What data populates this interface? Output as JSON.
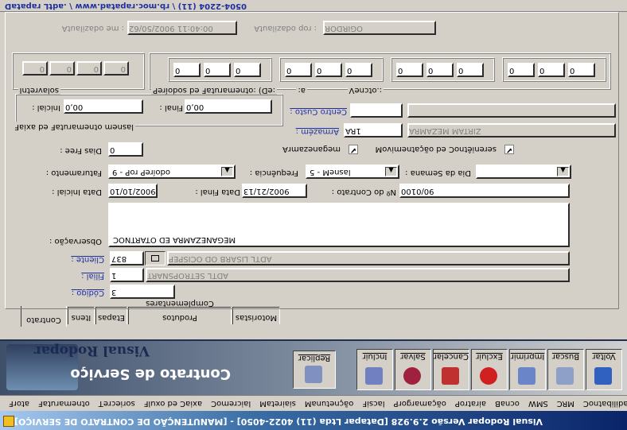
{
  "window_title": "Visual Rodopar Versão 2.9.928 [Datapar Ltda (11) 4022-4050]  - [MANUTENÇÃO DE CONTRATO DE SERVIÇO]",
  "menu": [
    "Frota",
    "Faturamento",
    "Terceiros",
    "Fluxo de Caixa",
    "Comercial",
    "Materiais",
    "Manutenção",
    "Fiscal",
    "Programação",
    "Portaria",
    "Banco",
    "WMS",
    "CRM",
    "Contabilidade"
  ],
  "banner": {
    "logo_text": "Visual Rodopar",
    "subtitle": "Contrato de Serviço"
  },
  "toolbar": {
    "replicar": "Replicar",
    "incluir": "Incluir",
    "salvar": "Salvar",
    "cancelar": "Cancelar",
    "excluir": "Excluir",
    "imprimir": "Imprimir",
    "buscar": "Buscar",
    "voltar": "Voltar"
  },
  "tabs": [
    "Contrato",
    "Itens",
    "Etapas",
    "Produtos Complementares",
    "Motoristas"
  ],
  "form": {
    "codigo_label": "Código :",
    "codigo_value": "3",
    "filial_label": "Filial :",
    "filial_value": "1",
    "filial_name": "TRANSPORTES LTDA",
    "cliente_label": "Cliente :",
    "cliente_value": "738",
    "cliente_name": "PEPSICO DO BRASIL LTDA",
    "observacao_label": "Observação :",
    "observacao_value": "CONTRATO DE ARMAZENAGEM",
    "data_inicial_label": "Data Inicial :",
    "data_inicial_value": "01/01/2009",
    "data_final_label": "Data Final :",
    "data_final_value": "31/12/2009",
    "nr_contrato_label": "Nº do Contrato :",
    "nr_contrato_value": "0010/09",
    "faturamento_label": "Faturamento :",
    "faturamento_value": "9 - Por Período",
    "frequencia_label": "Frequência :",
    "frequencia_value": "5 - Mensal",
    "dia_semana_label": "Dia da Semana :",
    "dia_semana_value": "",
    "dias_free_label": "Dias Free :",
    "dias_free_value": "0",
    "armazenagem_label": "Armazenagem",
    "armazenagem_checked": "✔",
    "movimentacao_label": "Movimentação de Contêineres",
    "movimentacao_checked": "✔",
    "armazem_label": "Armazém :",
    "armazem_value": "AR1",
    "armazem_name": "ARMAZEM MATRIZ",
    "centro_custo_label": "Centro Custo :",
    "centro_custo_value": "",
    "centro_custo_name": "",
    "faixa_group_label": "Faixa de Faturamento mensal",
    "inicial_label": "Inicial :",
    "inicial_value": "0,00",
    "final_label": "Final :",
    "final_value": "0,00",
    "intervalos_label": "Intervalos",
    "intervalos_values": [
      "0",
      "0",
      "0",
      "0"
    ],
    "periodos_label": "Períodos de Faturamento: (De:",
    "a_label": "a:",
    "vencto_label": "Vencto.:",
    "periodos_values": [
      [
        "0",
        "0",
        "0"
      ],
      [
        "0",
        "0",
        "0"
      ],
      [
        "0",
        "0",
        "0"
      ],
      [
        "0",
        "0",
        "0"
      ]
    ],
    "atualizado_por_label": "Atualizado por :",
    "atualizado_por_value": "RODRIGO",
    "atualizado_em_label": "Atualizado em :",
    "atualizado_em_value": "26/05/2009 11:04:00"
  },
  "status_bar": "Datapar Ltda.  \\  www.datapar.com.br \\ (11) 4022-4050"
}
